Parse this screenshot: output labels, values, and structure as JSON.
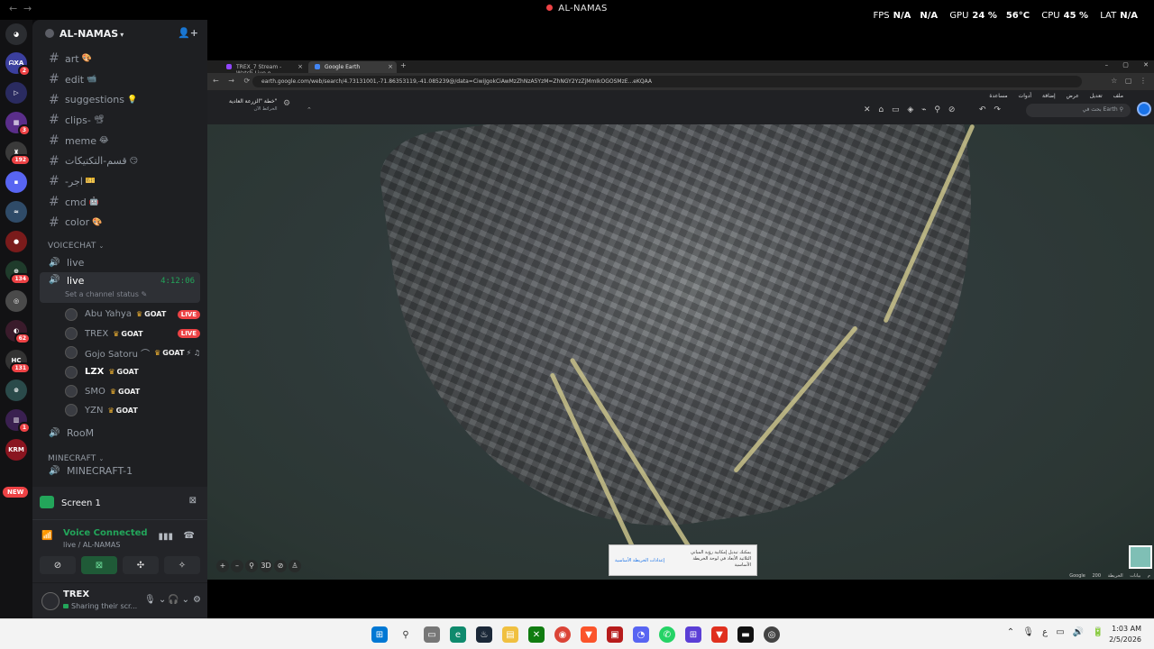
{
  "window": {
    "title": "AL-NAMAS"
  },
  "overlay": {
    "fps_label": "FPS",
    "fps_value": "N/A",
    "fps_value2": "N/A",
    "gpu_label": "GPU",
    "gpu_value": "24 %",
    "gpu_temp": "56°C",
    "cpu_label": "CPU",
    "cpu_value": "45 %",
    "lat_label": "LAT",
    "lat_value": "N/A"
  },
  "rail": {
    "servers": [
      {
        "label": "ᗣXA",
        "badge": "2",
        "color": "#3b3f9e"
      },
      {
        "label": "▷",
        "badge": "",
        "color": "#2a2b60"
      },
      {
        "label": "▦",
        "badge": "3",
        "color": "#5a2e8a"
      },
      {
        "label": "♜",
        "badge": "192",
        "color": "#3a3a3a"
      },
      {
        "label": "▪",
        "badge": "",
        "color": "#5865f2"
      },
      {
        "label": "≈",
        "badge": "",
        "color": "#2f4b68"
      },
      {
        "label": "●",
        "badge": "",
        "color": "#7a1b1b"
      },
      {
        "label": "⊕",
        "badge": "134",
        "color": "#1f3b2b"
      },
      {
        "label": "◎",
        "badge": "",
        "color": "#4a4a4a"
      },
      {
        "label": "◐",
        "badge": "62",
        "color": "#3a1b2b"
      },
      {
        "label": "HC",
        "badge": "131",
        "color": "#333"
      },
      {
        "label": "⊚",
        "badge": "",
        "color": "#2a4a4a"
      },
      {
        "label": "▥",
        "badge": "1",
        "color": "#3a2050"
      },
      {
        "label": "KRM",
        "badge": "",
        "color": "#8a1520"
      }
    ],
    "new_label": "NEW"
  },
  "server": {
    "name": "AL-NAMAS"
  },
  "channels": [
    {
      "name": "art",
      "emoji": "🎨"
    },
    {
      "name": "edit",
      "emoji": "📹"
    },
    {
      "name": "suggestions",
      "emoji": "💡"
    },
    {
      "name": "clips-",
      "emoji": "📽"
    },
    {
      "name": "meme",
      "emoji": "😂"
    },
    {
      "name": "قسم-التكتيكات",
      "emoji": "😏"
    },
    {
      "name": "-اجر",
      "emoji": "🎫"
    },
    {
      "name": "cmd",
      "emoji": "🤖"
    },
    {
      "name": "color",
      "emoji": "🎨"
    }
  ],
  "voicechat": {
    "category": "VOICECHAT",
    "live1": "live",
    "active": {
      "name": "live",
      "timer": "4:12:06",
      "status": "Set a channel status"
    },
    "members": [
      {
        "name": "Abu Yahya",
        "badge": "GOAT",
        "live": "LIVE",
        "extra": ""
      },
      {
        "name": "TREX",
        "badge": "GOAT",
        "live": "LIVE",
        "extra": ""
      },
      {
        "name": "Gojo Satoru ⌒",
        "badge": "GOAT",
        "live": "",
        "extra": "⚡ ♫"
      },
      {
        "name": "LZX",
        "badge": "GOAT",
        "live": "",
        "extra": ""
      },
      {
        "name": "SMO",
        "badge": "GOAT",
        "live": "",
        "extra": ""
      },
      {
        "name": "YZN",
        "badge": "GOAT",
        "live": "",
        "extra": ""
      }
    ],
    "room": "RooM"
  },
  "minecraft": {
    "category": "MINECRAFT",
    "channel": "MINECRAFT-1"
  },
  "screen_panel": {
    "label": "Screen 1"
  },
  "voice_panel": {
    "status": "Voice Connected",
    "sub": "live / AL-NAMAS"
  },
  "user_panel": {
    "name": "TREX",
    "status": "Sharing their scr..."
  },
  "browser": {
    "tab1": "TREX_7 Stream - Watch Live o",
    "tab2": "Google Earth",
    "url": "earth.google.com/web/search/4.73131001,-71.86353119,-41.085239@/data=CiwiJgokCiAwMzZhNzA5YzM=ZhNGY2YzZjMmIkOGOSMzE...eKQAA",
    "project_title": "خطة \"الزرعة العادية\"",
    "project_sub": "الخرائط الآن",
    "menus": [
      "ملف",
      "تعديل",
      "عرض",
      "إضافة",
      "أدوات",
      "مساعدة"
    ],
    "search_placeholder": "بحث في Earth",
    "notice_text": "يمكنك تبديل إمكانية رؤية المباني الثلاثية الأبعاد في لوحة الخريطة الأساسية",
    "notice_link": "إعدادات الخريطة الأساسية",
    "scale": "Google  200 م  بيانات الخريطة"
  },
  "taskbar": {
    "time": "1:03 AM",
    "date": "2/5/2026",
    "lang": "ع"
  }
}
